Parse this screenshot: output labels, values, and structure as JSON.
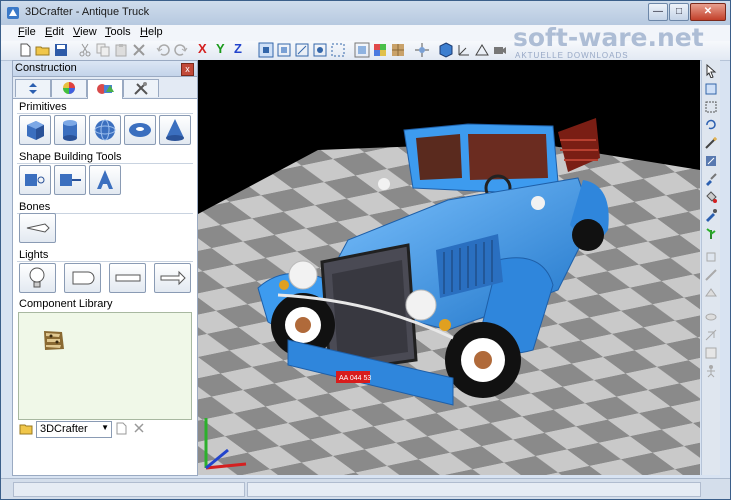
{
  "window": {
    "title": "3DCrafter - Antique Truck",
    "controls": {
      "minimize": "—",
      "maximize": "□",
      "close": "✕"
    }
  },
  "menu": {
    "items": [
      {
        "label": "File",
        "key": "F",
        "rest": "ile"
      },
      {
        "label": "Edit",
        "key": "E",
        "rest": "dit"
      },
      {
        "label": "View",
        "key": "V",
        "rest": "iew"
      },
      {
        "label": "Tools",
        "key": "T",
        "rest": "ools"
      },
      {
        "label": "Help",
        "key": "H",
        "rest": "elp"
      }
    ]
  },
  "toolbar": {
    "axis_x": "X",
    "axis_y": "Y",
    "axis_z": "Z",
    "colors": {
      "x": "#d42020",
      "y": "#1a9a1a",
      "z": "#2244cc"
    }
  },
  "watermark": {
    "brand": "soft-ware.net",
    "tagline": "AKTUELLE DOWNLOADS"
  },
  "panel": {
    "title": "Construction",
    "close": "x",
    "tabs": [
      "arrows-icon",
      "color-wheel-icon",
      "shapes-icon",
      "tools-icon"
    ],
    "active_tab": 2,
    "sections": {
      "primitives": "Primitives",
      "shape_tools": "Shape Building Tools",
      "bones": "Bones",
      "lights": "Lights",
      "library": "Component Library"
    },
    "primitives": [
      "cube-icon",
      "cylinder-icon",
      "sphere-icon",
      "torus-icon",
      "cone-icon"
    ],
    "shape_tools": [
      "lathe-icon",
      "extrude-icon",
      "text-3d-icon"
    ],
    "lights": [
      "omni-light-icon",
      "spot-light-icon",
      "linear-light-icon",
      "directional-light-icon"
    ],
    "library_select": "3DCrafter"
  },
  "scene": {
    "plate": "AA 044 53",
    "body_color": "#3d9bef",
    "floor_light": "#c9c9c9",
    "floor_dark": "#8a8a8a"
  }
}
